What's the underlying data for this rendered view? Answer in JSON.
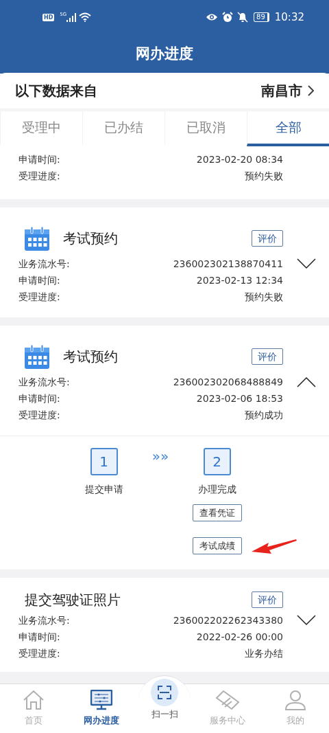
{
  "status_bar": {
    "hd_label": "HD",
    "network": "5G",
    "battery": "89",
    "time": "10:32"
  },
  "header": {
    "title": "网办进度"
  },
  "source": {
    "label": "以下数据来自",
    "city": "南昌市"
  },
  "tabs": [
    {
      "label": "受理中",
      "selected": false
    },
    {
      "label": "已办结",
      "selected": false
    },
    {
      "label": "已取消",
      "selected": false
    },
    {
      "label": "全部",
      "selected": true
    }
  ],
  "records": [
    {
      "kind": "partial",
      "fields": [
        {
          "label": "申请时间:",
          "value": "2023-02-20 08:34"
        },
        {
          "label": "受理进度:",
          "value": "预约失败"
        }
      ]
    },
    {
      "kind": "appointment",
      "title": "考试预约",
      "rate_button": "评价",
      "expanded": false,
      "fields": [
        {
          "label": "业务流水号:",
          "value": "236002302138870411"
        },
        {
          "label": "申请时间:",
          "value": "2023-02-13 12:34"
        },
        {
          "label": "受理进度:",
          "value": "预约失败"
        }
      ]
    },
    {
      "kind": "appointment",
      "title": "考试预约",
      "rate_button": "评价",
      "expanded": true,
      "fields": [
        {
          "label": "业务流水号:",
          "value": "236002302068488849"
        },
        {
          "label": "申请时间:",
          "value": "2023-02-06 18:53"
        },
        {
          "label": "受理进度:",
          "value": "预约成功"
        }
      ],
      "steps": [
        {
          "number": "1",
          "label": "提交申请"
        },
        {
          "number": "2",
          "label": "办理完成",
          "actions": [
            "查看凭证",
            "考试成绩"
          ]
        }
      ],
      "step_separator": "»»"
    },
    {
      "kind": "upload",
      "title": "提交驾驶证照片",
      "rate_button": "评价",
      "expanded": false,
      "fields": [
        {
          "label": "业务流水号:",
          "value": "236002202262343380"
        },
        {
          "label": "申请时间:",
          "value": "2022-02-26 00:00"
        },
        {
          "label": "受理进度:",
          "value": "业务办结"
        }
      ]
    }
  ],
  "annotation": {
    "kind": "arrow"
  },
  "bottom_nav": [
    {
      "kind": "home",
      "label": "首页",
      "selected": false
    },
    {
      "kind": "progress",
      "label": "网办进度",
      "selected": true
    },
    {
      "kind": "scan",
      "label": "扫一扫",
      "selected": false
    },
    {
      "kind": "service",
      "label": "服务中心",
      "selected": false
    },
    {
      "kind": "profile",
      "label": "我的",
      "selected": false
    }
  ]
}
